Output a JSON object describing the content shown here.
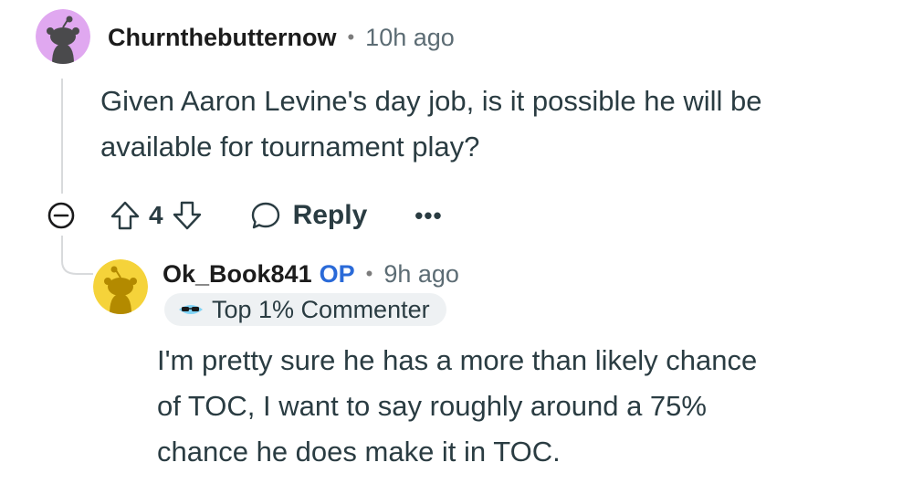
{
  "comments": [
    {
      "username": "Churnthebutternow",
      "separator": "•",
      "time": "10h ago",
      "body_lines": [
        "Given Aaron Levine's day job, is it possible he will be",
        "available for tournament play?"
      ],
      "avatar": {
        "icon": "snoo-avatar",
        "bg_color": "#e0a8f0"
      },
      "actions": {
        "collapse_icon": "collapse-minus-icon",
        "upvote_icon": "upvote-arrow-icon",
        "score": "4",
        "downvote_icon": "downvote-arrow-icon",
        "reply_icon": "speech-bubble-icon",
        "reply_label": "Reply",
        "more_label": "•••"
      }
    },
    {
      "username": "Ok_Book841",
      "op_label": "OP",
      "separator": "•",
      "time": "9h ago",
      "badge": {
        "icon": "sunglasses-icon",
        "label": "Top 1% Commenter"
      },
      "body_lines": [
        "I'm pretty sure he has a more than likely chance",
        "of TOC, I want to say roughly around a 75%",
        "chance he does make it in TOC."
      ],
      "avatar": {
        "icon": "snoo-avatar",
        "bg_color": "#f5d33a"
      }
    }
  ],
  "colors": {
    "op": "#2a6ad8",
    "thread_line": "#d8dadc",
    "text": "#2a3c42"
  }
}
